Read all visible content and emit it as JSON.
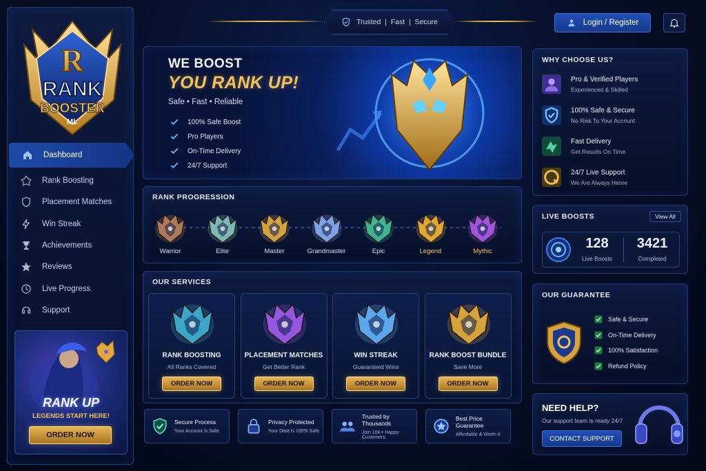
{
  "brand": {
    "logo_letter": "R",
    "logo_line1": "RANK",
    "logo_line2": "BOOSTER",
    "logo_line3": "ML"
  },
  "colors": {
    "accent_blue": "#1e4ba8",
    "gold": "#f3c25a",
    "bg": "#040a1c",
    "success_green": "#2fbf5b"
  },
  "topbar": {
    "badge": "Trusted  |  Fast  |  Secure",
    "login_label": "Login / Register"
  },
  "sidebar": {
    "items": [
      {
        "label": "Dashboard",
        "icon": "home-icon",
        "active": true
      },
      {
        "label": "Rank Boosting",
        "icon": "rank-icon",
        "active": false
      },
      {
        "label": "Placement Matches",
        "icon": "shield-icon",
        "active": false
      },
      {
        "label": "Win Streak",
        "icon": "streak-icon",
        "active": false
      },
      {
        "label": "Achievements",
        "icon": "trophy-icon",
        "active": false
      },
      {
        "label": "Reviews",
        "icon": "star-icon",
        "active": false
      },
      {
        "label": "Live Progress",
        "icon": "progress-icon",
        "active": false
      },
      {
        "label": "Support",
        "icon": "support-icon",
        "active": false
      }
    ],
    "promo": {
      "title": "RANK UP",
      "subtitle": "LEGENDS START HERE!",
      "button": "ORDER NOW"
    }
  },
  "hero": {
    "line1": "WE BOOST",
    "line2": "YOU RANK UP!",
    "tagline": "Safe • Fast • Reliable",
    "checks": [
      "100% Safe Boost",
      "Pro Players",
      "On-Time Delivery",
      "24/7 Support"
    ]
  },
  "rank_progression": {
    "title": "RANK PROGRESSION",
    "ranks": [
      {
        "name": "Warrior",
        "color": "#b07a54"
      },
      {
        "name": "Elite",
        "color": "#7fb9b4"
      },
      {
        "name": "Master",
        "color": "#d4a23e"
      },
      {
        "name": "Grandmaster",
        "color": "#7fa2e6"
      },
      {
        "name": "Epic",
        "color": "#3fb58f"
      },
      {
        "name": "Legend",
        "color": "#e3a630"
      },
      {
        "name": "Mythic",
        "color": "#a455e0"
      }
    ]
  },
  "services": {
    "title": "OUR SERVICES",
    "items": [
      {
        "title": "RANK BOOSTING",
        "subtitle": "All Ranks Covered",
        "button": "ORDER NOW",
        "color": "#3aa7c9"
      },
      {
        "title": "PLACEMENT MATCHES",
        "subtitle": "Get Better Rank",
        "button": "ORDER NOW",
        "color": "#9458e0"
      },
      {
        "title": "WIN STREAK",
        "subtitle": "Guaranteed Wins",
        "button": "ORDER NOW",
        "color": "#5aa7ee"
      },
      {
        "title": "RANK BOOST BUNDLE",
        "subtitle": "Save More",
        "button": "ORDER NOW",
        "color": "#d7a23c"
      }
    ]
  },
  "features": [
    {
      "title": "Secure Process",
      "subtitle": "Your Account is Safe",
      "icon": "shield-check-icon"
    },
    {
      "title": "Privacy Protected",
      "subtitle": "Your Data is 100% Safe",
      "icon": "lock-icon"
    },
    {
      "title": "Trusted by Thousands",
      "subtitle": "Join 10K+ Happy Customers",
      "icon": "users-icon"
    },
    {
      "title": "Best Price Guarantee",
      "subtitle": "Affordable & Worth it",
      "icon": "badge-icon"
    }
  ],
  "why": {
    "title": "WHY CHOOSE US?",
    "items": [
      {
        "title": "Pro & Verified Players",
        "subtitle": "Experienced & Skilled",
        "icon": "player-icon"
      },
      {
        "title": "100% Safe & Secure",
        "subtitle": "No Risk To Your Account",
        "icon": "shield-icon"
      },
      {
        "title": "Fast Delivery",
        "subtitle": "Get Results On Time",
        "icon": "delivery-icon"
      },
      {
        "title": "24/7 Live Support",
        "subtitle": "We Are Always Henre",
        "icon": "support-icon"
      }
    ]
  },
  "live_boosts": {
    "title": "LIVE BOOSTS",
    "view_all": "View All",
    "live_count": "128",
    "live_label": "Live Boosts",
    "completed_count": "3421",
    "completed_label": "Completed"
  },
  "guarantee": {
    "title": "OUR GUARANTEE",
    "items": [
      "Safe & Secure",
      "On-Time Delivery",
      "100% Satisfaction",
      "Refund Policy"
    ]
  },
  "help": {
    "title": "NEED HELP?",
    "subtitle": "Our support team is ready 24/7",
    "button": "CONTACT SUPPORT"
  }
}
